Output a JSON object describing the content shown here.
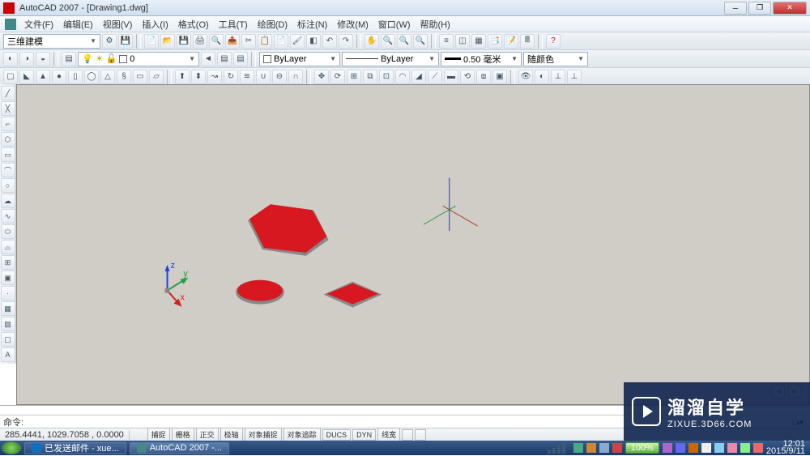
{
  "title": "AutoCAD 2007 - [Drawing1.dwg]",
  "menus": [
    "文件(F)",
    "编辑(E)",
    "视图(V)",
    "插入(I)",
    "格式(O)",
    "工具(T)",
    "绘图(D)",
    "标注(N)",
    "修改(M)",
    "窗口(W)",
    "帮助(H)"
  ],
  "workspace_combo": "三维建模",
  "layer_combo": "0",
  "bylayer": "ByLayer",
  "bylayer2": "ByLayer",
  "lineweight": "0.50 毫米",
  "color_combo": "随颜色",
  "cmd_label": "命令:",
  "coords": "285.4441, 1029.7058 , 0.0000",
  "status_toggles": [
    "捕捉",
    "栅格",
    "正交",
    "极轴",
    "对象捕捉",
    "对象追踪",
    "DUCS",
    "DYN",
    "线宽"
  ],
  "taskbar": {
    "item1": "已发送邮件 - xue...",
    "item2": "AutoCAD 2007 -..."
  },
  "zoom": "100%",
  "clock_time": "12:01",
  "clock_date": "2015/9/11",
  "watermark": {
    "big": "溜溜自学",
    "url": "ZIXUE.3D66.COM"
  }
}
